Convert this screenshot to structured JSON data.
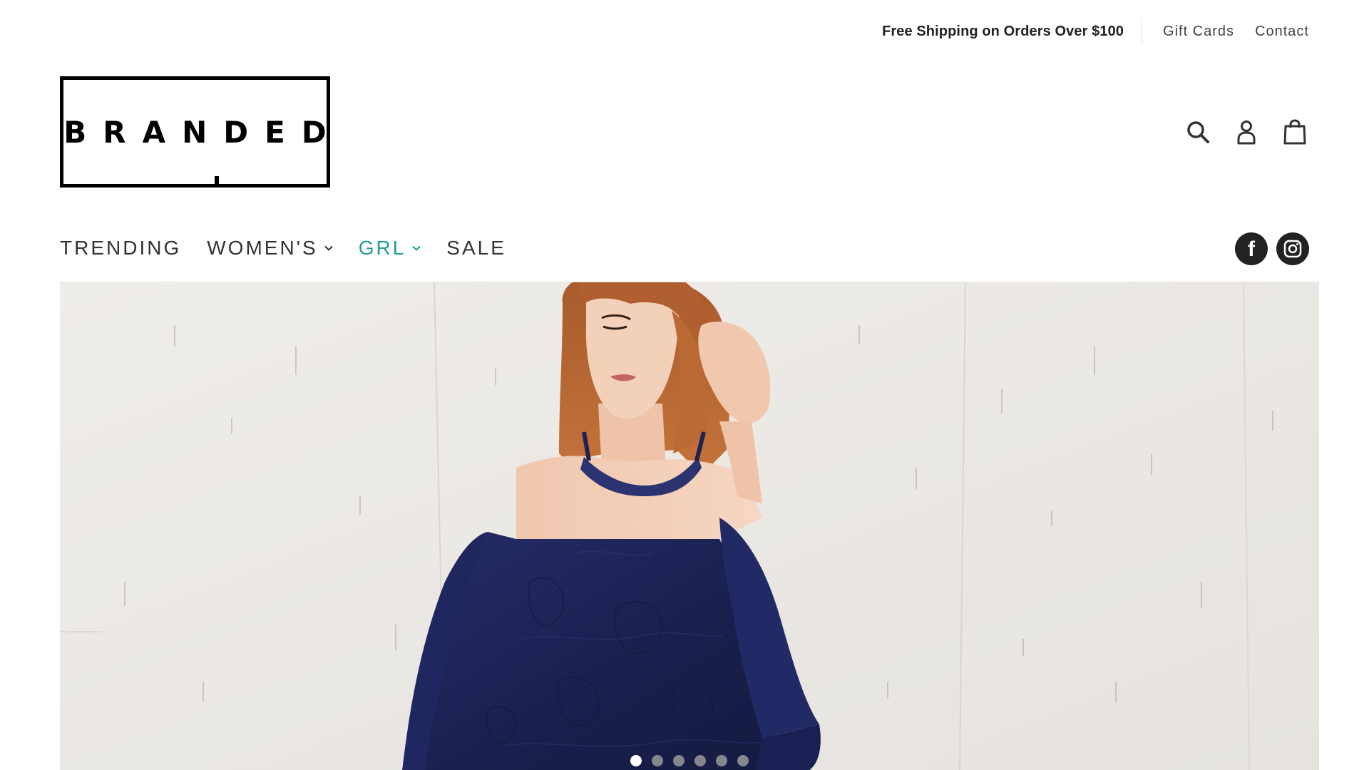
{
  "topbar": {
    "promo": "Free Shipping on Orders Over $100",
    "links": [
      "Gift Cards",
      "Contact"
    ]
  },
  "logo": {
    "text": "BRANDED"
  },
  "header_icons": [
    "search-icon",
    "account-icon",
    "cart-icon"
  ],
  "nav": {
    "items": [
      {
        "label": "TRENDING",
        "has_dropdown": false
      },
      {
        "label": "WOMEN'S",
        "has_dropdown": true
      },
      {
        "label": "GRL",
        "has_dropdown": true,
        "active": true
      },
      {
        "label": "SALE",
        "has_dropdown": false
      }
    ]
  },
  "social": [
    "facebook-icon",
    "instagram-icon"
  ],
  "colors": {
    "accent": "#1f9e96",
    "text": "#333333",
    "dress": "#1d2459",
    "hair": "#b5622c",
    "wall": "#ecebe7"
  },
  "hero": {
    "slide_count": 6,
    "active_slide": 1
  }
}
